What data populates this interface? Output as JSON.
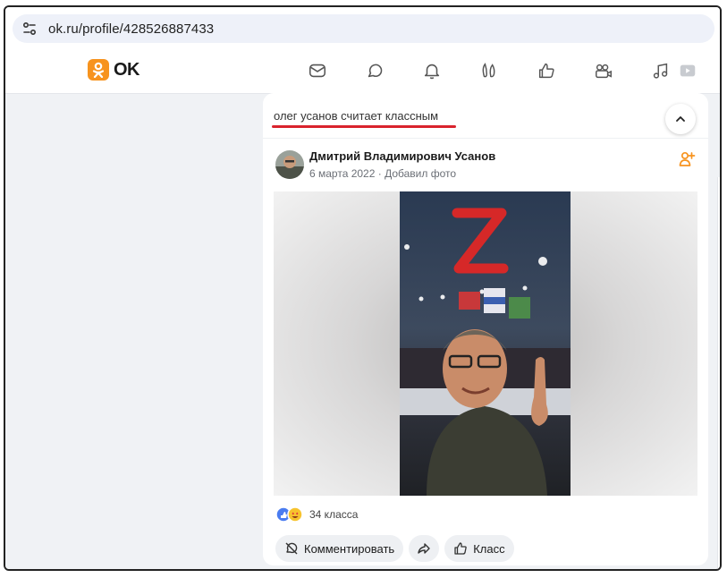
{
  "browser": {
    "url": "ok.ru/profile/428526887433"
  },
  "header": {
    "logo_text": "OK",
    "nav_icons": [
      "mail-icon",
      "chat-bubble-icon",
      "bell-icon",
      "guests-icon",
      "like-icon",
      "video-icon",
      "music-icon"
    ],
    "brand_color": "#f7931e"
  },
  "post": {
    "liker_line": "олег усанов считает классным",
    "author": "Дмитрий Владимирович Усанов",
    "meta": "6 марта 2022 · Добавил фото",
    "photo_letter": "Z",
    "reaction_count": "34 класса",
    "actions": {
      "comment_label": "Комментировать",
      "class_label": "Класс"
    },
    "accent_color": "#d9232d"
  }
}
